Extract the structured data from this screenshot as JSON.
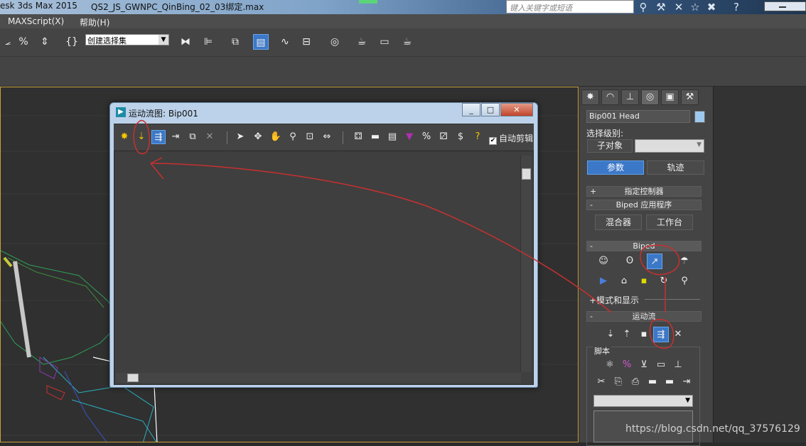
{
  "title_bar": {
    "app_title": "esk 3ds Max  2015",
    "file_name": "QS2_JS_GWNPC_QinBing_02_03绑定.max",
    "search_placeholder": "键入关键字或短语",
    "icons": [
      "binoculars-icon",
      "wrench-icon",
      "x-icon",
      "star-icon",
      "x-logo-icon",
      "help-icon",
      "minimize-icon"
    ]
  },
  "menu_bar": {
    "items": [
      "MAXScript(X)",
      "帮助(H)"
    ]
  },
  "main_toolbar": {
    "selection_set_value": "创建选择集",
    "icons": [
      "snap-icon",
      "percent-snap-icon",
      "spinner-snap-icon",
      "edit-named-selection-icon",
      "mirror-icon",
      "align-icon",
      "layer-icon",
      "scene-explorer-icon",
      "curve-editor-icon",
      "schematic-view-icon",
      "material-editor-icon",
      "render-setup-icon",
      "render-frame-icon",
      "render-icon"
    ]
  },
  "dialog": {
    "title": "运动流图: Bip001",
    "auto_clip_label": "自动剪辑",
    "auto_clip_checked": "✔",
    "toolbar_icons": [
      "create-clip-icon",
      "load-clip-icon",
      "show-graph-icon",
      "define-transition-icon",
      "optimize-icon",
      "delete-icon",
      "select-icon",
      "move-icon",
      "pan-icon",
      "zoom-icon",
      "zoom-extents-icon",
      "frame-icon",
      "create-random-icon",
      "unify-icon",
      "layout-icon",
      "color-icon",
      "percent-icon",
      "random-icon",
      "dollar-icon",
      "info-icon"
    ]
  },
  "command_panel": {
    "tabs": [
      "create-tab-icon",
      "modify-tab-icon",
      "hierarchy-tab-icon",
      "motion-tab-icon",
      "display-tab-icon",
      "utilities-tab-icon"
    ],
    "object_name": "Bip001 Head",
    "object_color": "#9ec9ef",
    "selection_level_label": "选择级别:",
    "sub_object_button": "子对象",
    "params_button": "参数",
    "track_button": "轨迹",
    "rollouts": {
      "assign_controller": "指定控制器",
      "biped_apps": "Biped 应用程序",
      "mixer_button": "混合器",
      "workbench_button": "工作台",
      "biped": "Biped",
      "mode_display": "+模式和显示",
      "motion_flow": "运动流",
      "script": "脚本"
    },
    "plus": "+",
    "minus": "-"
  },
  "watermark": "https://blog.csdn.net/qq_37576129",
  "colors": {
    "accent": "#3c78c8",
    "annotation": "#c83030",
    "viewport_border": "#c8a23c"
  }
}
